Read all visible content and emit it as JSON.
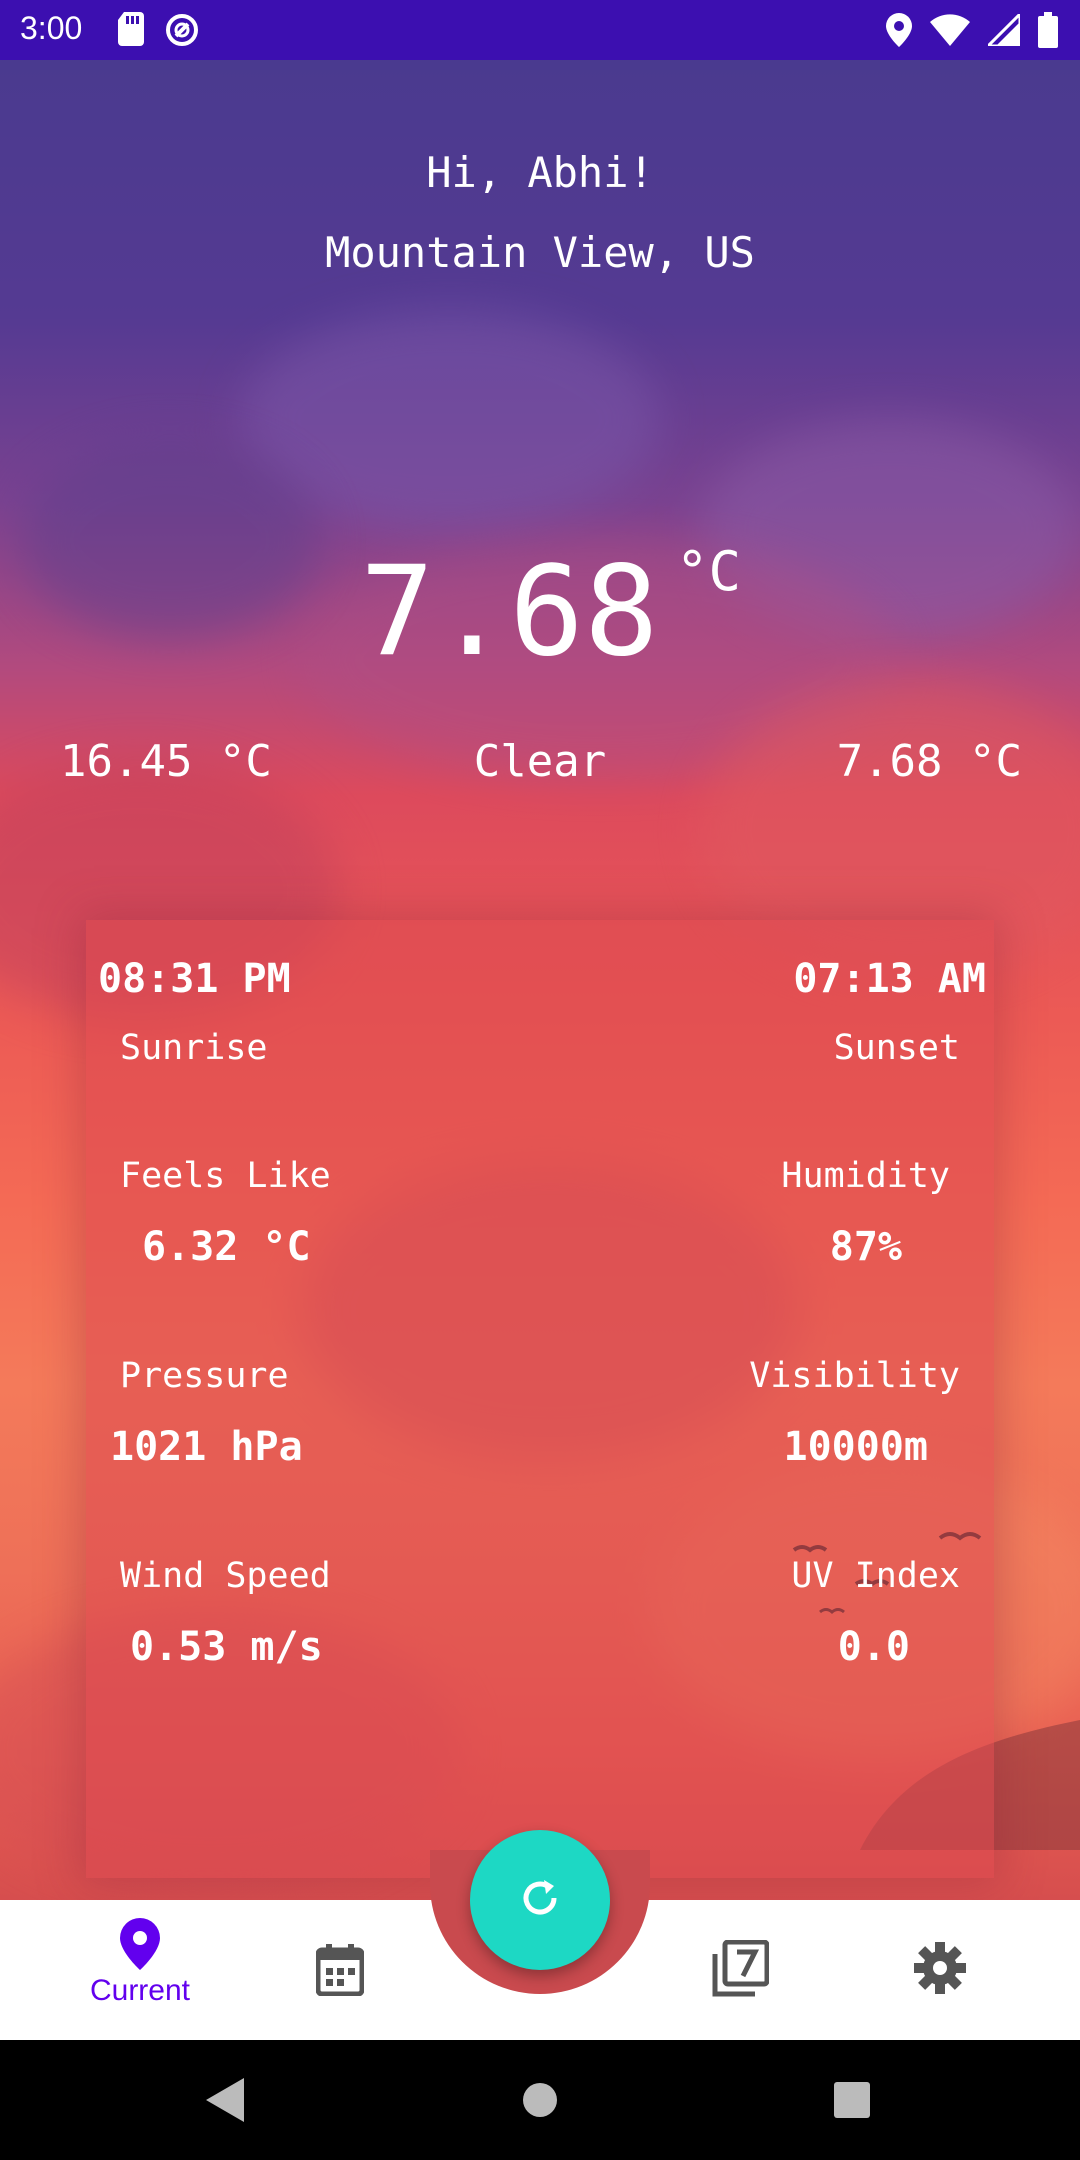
{
  "status_bar": {
    "time": "3:00",
    "left_icons": [
      "sd-card-icon",
      "data-saver-icon"
    ],
    "right_icons": [
      "location-icon",
      "wifi-icon",
      "signal-icon",
      "battery-icon"
    ],
    "background": "#3c0fb0"
  },
  "header": {
    "greeting": "Hi, Abhi!",
    "location": "Mountain View, US"
  },
  "current": {
    "temperature": "7.68",
    "unit": "°C",
    "temp_max": "16.45 °C",
    "condition": "Clear",
    "temp_min": "7.68 °C"
  },
  "details": {
    "sunrise_time": "08:31 PM",
    "sunrise_label": "Sunrise",
    "sunset_time": "07:13 AM",
    "sunset_label": "Sunset",
    "feels_like_label": "Feels Like",
    "feels_like_value": "6.32 °C",
    "humidity_label": "Humidity",
    "humidity_value": "87%",
    "pressure_label": "Pressure",
    "pressure_value": "1021 hPa",
    "visibility_label": "Visibility",
    "visibility_value": "10000m",
    "wind_label": "Wind Speed",
    "wind_value": "0.53 m/s",
    "uv_label": "UV Index",
    "uv_value": "0.0"
  },
  "bottom_nav": {
    "items": [
      {
        "icon": "location-pin-icon",
        "label": "Current",
        "active": true
      },
      {
        "icon": "calendar-icon",
        "label": "",
        "active": false
      },
      {
        "icon": "seven-day-icon",
        "label": "",
        "active": false
      },
      {
        "icon": "settings-icon",
        "label": "",
        "active": false
      }
    ],
    "fab_icon": "refresh-icon",
    "active_color": "#6200ee",
    "fab_color": "#1dd8c4"
  },
  "system_nav": [
    "back-icon",
    "home-icon",
    "recents-icon"
  ]
}
